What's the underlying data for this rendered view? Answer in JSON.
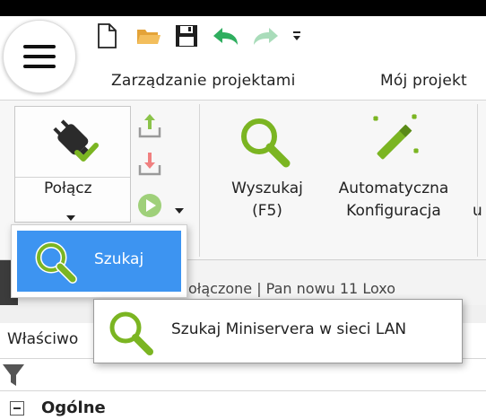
{
  "tabs": [
    {
      "label": "Zarządzanie projektami"
    },
    {
      "label": "Mój projekt"
    }
  ],
  "ribbon": {
    "connect_label": "Połącz",
    "search_label_line1": "Wyszukaj",
    "search_label_line2": "(F5)",
    "autoconfig_label_line1": "Automatyczna",
    "autoconfig_label_line2": "Konfiguracja",
    "partial_label": "u"
  },
  "dropdown": {
    "item_label": "Szukaj"
  },
  "tooltip": {
    "text": "Szukaj Miniservera w sieci LAN"
  },
  "behind": {
    "obscured_text": "ołączone  |  Pan nowu 11 Loxo"
  },
  "properties": {
    "label": "Właściwo",
    "section": "Ogólne"
  },
  "colors": {
    "accent_blue": "#3d94f1",
    "icon_green": "#7bb522",
    "undo_green": "#2fae5f"
  }
}
